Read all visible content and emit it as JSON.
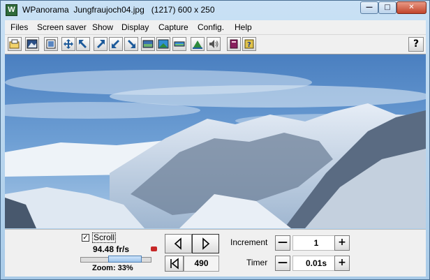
{
  "window": {
    "app_icon_letter": "W",
    "title": "WPanorama  Jungfraujoch04.jpg   (1217) 600 x 250",
    "minimize_glyph": "—",
    "maximize_glyph": "□",
    "close_glyph": "✕"
  },
  "menu": {
    "items": [
      "Files",
      "Screen saver",
      "Show",
      "Display",
      "Capture",
      "Config.",
      "Help"
    ]
  },
  "toolbar": {
    "icons": [
      "open-file-icon",
      "image-icon",
      "full-screen-icon",
      "resize-icon",
      "arrow-up-left-icon",
      "arrow-up-right-icon",
      "arrow-down-left-icon",
      "arrow-down-right-icon",
      "panorama-icon",
      "sky-panorama-icon",
      "strip-panorama-icon",
      "landscape-icon",
      "sound-icon",
      "book-icon",
      "help-book-icon"
    ],
    "help_label": "?"
  },
  "controls": {
    "scroll_checked": true,
    "check_mark": "✓",
    "scroll_label": "Scroll",
    "fps": "94.48 fr/s",
    "zoom": "Zoom: 33%",
    "zoom_percent": 33,
    "position": "490",
    "increment_label": "Increment",
    "increment_value": "1",
    "timer_label": "Timer",
    "timer_value": "0.01s",
    "minus": "—",
    "plus": "+"
  },
  "colors": {
    "sky": "#5f93cf",
    "snow": "#dbe6f2",
    "rock": "#48586d",
    "accent": "#c62828"
  }
}
